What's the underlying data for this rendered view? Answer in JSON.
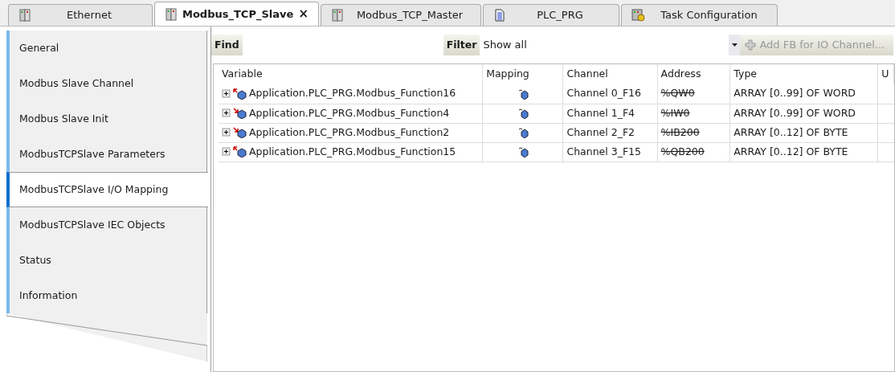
{
  "tabs": [
    {
      "label": "Ethernet",
      "kind": "device",
      "selected": false
    },
    {
      "label": "Modbus_TCP_Slave",
      "kind": "device",
      "selected": true,
      "close": "×"
    },
    {
      "label": "Modbus_TCP_Master",
      "kind": "device",
      "selected": false
    },
    {
      "label": "PLC_PRG",
      "kind": "program",
      "selected": false
    },
    {
      "label": "Task Configuration",
      "kind": "task",
      "selected": false
    }
  ],
  "sidebar": {
    "items": [
      {
        "label": "General",
        "selected": false
      },
      {
        "label": "Modbus Slave Channel",
        "selected": false
      },
      {
        "label": "Modbus Slave Init",
        "selected": false
      },
      {
        "label": "ModbusTCPSlave Parameters",
        "selected": false
      },
      {
        "label": "ModbusTCPSlave I/O Mapping",
        "selected": true
      },
      {
        "label": "ModbusTCPSlave IEC Objects",
        "selected": false
      },
      {
        "label": "Status",
        "selected": false
      },
      {
        "label": "Information",
        "selected": false
      }
    ]
  },
  "toolbar": {
    "find_label": "Find",
    "filter_label": "Filter",
    "filter_value": "Show all",
    "add_button": {
      "label": "Add FB for IO Channel...",
      "disabled": true
    }
  },
  "table": {
    "columns": [
      "Variable",
      "Mapping",
      "Channel",
      "Address",
      "Type",
      "U"
    ],
    "rows": [
      {
        "variable": "Application.PLC_PRG.Modbus_Function16",
        "kind": "output",
        "channel": "Channel 0_F16",
        "address": "%QW0",
        "address_struck": true,
        "type": "ARRAY [0..99] OF WORD"
      },
      {
        "variable": "Application.PLC_PRG.Modbus_Function4",
        "kind": "input",
        "channel": "Channel 1_F4",
        "address": "%IW0",
        "address_struck": true,
        "type": "ARRAY [0..99] OF WORD"
      },
      {
        "variable": "Application.PLC_PRG.Modbus_Function2",
        "kind": "input",
        "channel": "Channel 2_F2",
        "address": "%IB200",
        "address_struck": true,
        "type": "ARRAY [0..12] OF BYTE"
      },
      {
        "variable": "Application.PLC_PRG.Modbus_Function15",
        "kind": "output",
        "channel": "Channel 3_F15",
        "address": "%QB200",
        "address_struck": true,
        "type": "ARRAY [0..12] OF BYTE"
      }
    ]
  }
}
